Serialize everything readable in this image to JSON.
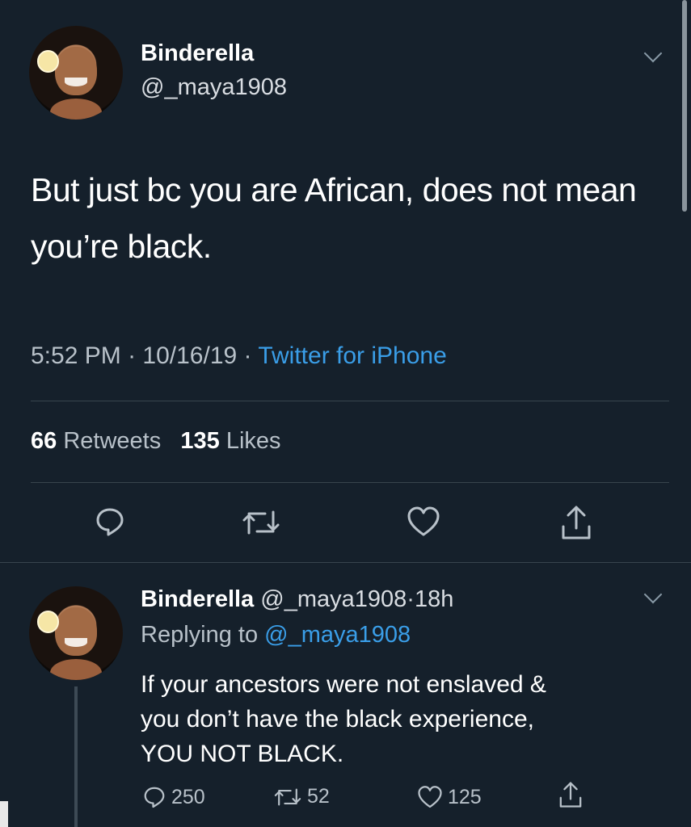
{
  "main_tweet": {
    "display_name": "Binderella",
    "handle": "@_maya1908",
    "text": "But just bc you are African, does not mean you’re black.",
    "time": "5:52 PM",
    "date": "10/16/19",
    "separator": "·",
    "source": "Twitter for iPhone",
    "retweets_count": "66",
    "retweets_label": "Retweets",
    "likes_count": "135",
    "likes_label": "Likes",
    "icons": [
      "reply-icon",
      "retweet-icon",
      "like-icon",
      "share-icon",
      "chevron-down-icon"
    ]
  },
  "reply_tweet": {
    "display_name": "Binderella",
    "handle": "@_maya1908",
    "age": "18h",
    "separator": "·",
    "replying_label": "Replying to",
    "replying_mention": "@_maya1908",
    "text_lines": [
      "If your ancestors were not enslaved &",
      "you don’t have the black experience,",
      "YOU NOT BLACK."
    ],
    "reply_count": "250",
    "retweet_count": "52",
    "like_count": "125"
  },
  "colors": {
    "background": "#15202b",
    "link": "#3a9ee8",
    "muted_text": "#b8c1c9",
    "divider": "#38444d"
  }
}
